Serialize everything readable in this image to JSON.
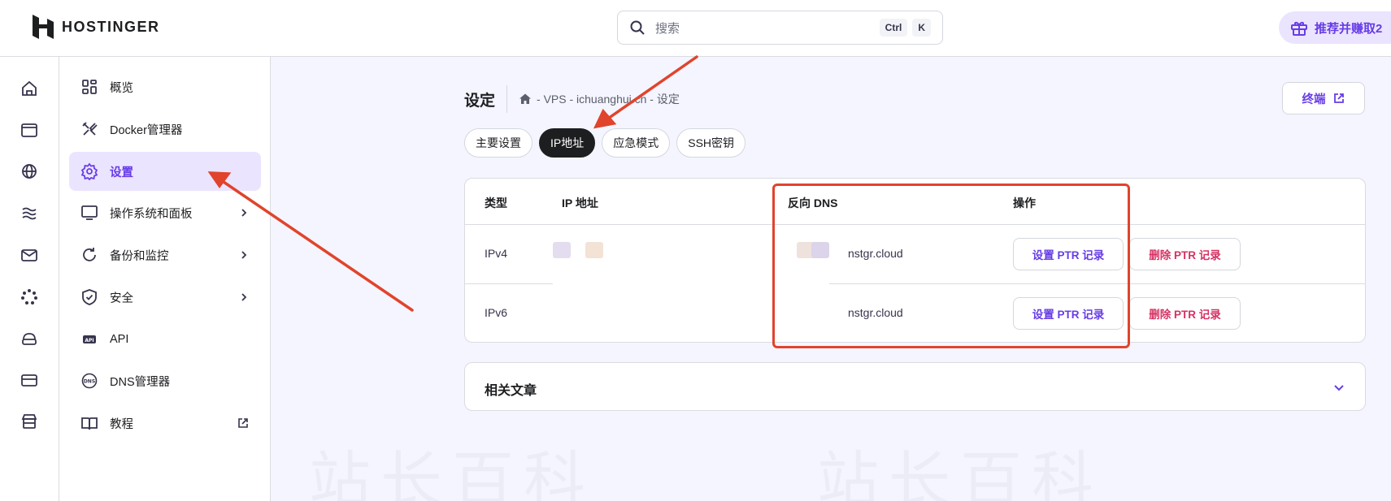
{
  "header": {
    "brand": "HOSTINGER",
    "search_placeholder": "搜索",
    "shortcut_ctrl": "Ctrl",
    "shortcut_key": "K",
    "refer_label": "推荐并赚取2"
  },
  "rail": {
    "icons": [
      "home-icon",
      "browser-window-icon",
      "globe-icon",
      "layers-icon",
      "mail-icon",
      "loading-icon",
      "cloud-server-icon",
      "credit-card-icon",
      "store-icon"
    ]
  },
  "sidebar": {
    "items": [
      {
        "label": "概览",
        "icon": "overview-grid-icon"
      },
      {
        "label": "Docker管理器",
        "icon": "tools-icon"
      },
      {
        "label": "设置",
        "icon": "gear-icon",
        "active": true
      },
      {
        "label": "操作系统和面板",
        "icon": "monitor-icon"
      },
      {
        "label": "备份和监控",
        "icon": "refresh-icon"
      },
      {
        "label": "安全",
        "icon": "shield-icon"
      },
      {
        "label": "API",
        "icon": "api-icon"
      },
      {
        "label": "DNS管理器",
        "icon": "dns-icon"
      },
      {
        "label": "教程",
        "icon": "book-icon"
      }
    ]
  },
  "main": {
    "title": "设定",
    "breadcrumb": "- VPS - ichuanghui.cn - 设定",
    "terminal_label": "终端",
    "tabs": [
      {
        "label": "主要设置"
      },
      {
        "label": "IP地址",
        "active": true
      },
      {
        "label": "应急模式"
      },
      {
        "label": "SSH密钥"
      }
    ],
    "table": {
      "headers": [
        "类型",
        "IP 地址",
        "反向 DNS",
        "操作"
      ],
      "rows": [
        {
          "type": "IPv4",
          "dns": "nstgr.cloud",
          "set_label": "设置 PTR 记录",
          "delete_label": "删除 PTR 记录"
        },
        {
          "type": "IPv6",
          "dns": "nstgr.cloud",
          "set_label": "设置 PTR 记录",
          "delete_label": "删除 PTR 记录"
        }
      ]
    },
    "related_title": "相关文章"
  },
  "colors": {
    "accent": "#673de6",
    "danger": "#d63163",
    "annotation": "#e0442c",
    "active_tab": "#1d1e20"
  }
}
